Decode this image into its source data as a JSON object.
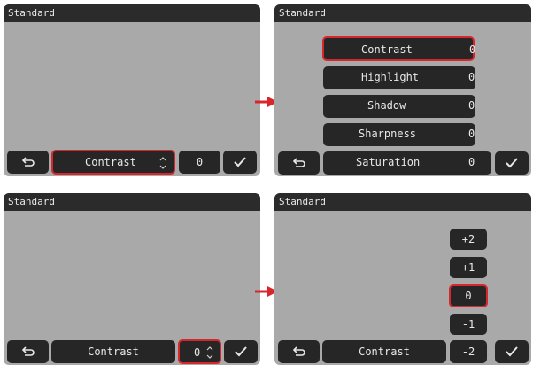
{
  "panels": [
    {
      "title": "Standard",
      "bottom": {
        "label": "Contrast",
        "value": "0"
      }
    },
    {
      "title": "Standard",
      "menu": [
        {
          "label": "Contrast",
          "value": "0"
        },
        {
          "label": "Highlight",
          "value": "0"
        },
        {
          "label": "Shadow",
          "value": "0"
        },
        {
          "label": "Sharpness",
          "value": "0"
        },
        {
          "label": "Saturation",
          "value": "0"
        }
      ]
    },
    {
      "title": "Standard",
      "bottom": {
        "label": "Contrast",
        "value": "0"
      }
    },
    {
      "title": "Standard",
      "bottom": {
        "label": "Contrast"
      },
      "values": [
        "+2",
        "+1",
        "0",
        "-1",
        "-2"
      ]
    }
  ],
  "accent_color": "#d6272c",
  "icons": {
    "back": "back-arrow-icon",
    "confirm": "checkmark-icon",
    "updown": "up-down-chevron-icon",
    "flow": "flow-arrow-icon"
  }
}
